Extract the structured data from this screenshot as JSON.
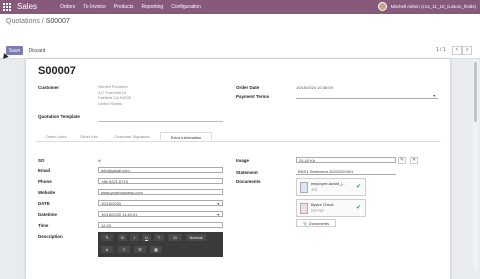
{
  "nav": {
    "app_name": "Sales",
    "menu": [
      "Orders",
      "To Invoice",
      "Products",
      "Reporting",
      "Configuration"
    ],
    "user": "Mitchell Admin (z14_11_10_custom_fields)"
  },
  "breadcrumb": {
    "parent": "Quotations",
    "sep": " / ",
    "current": "S00007"
  },
  "actions": {
    "save": "Save",
    "discard": "Discard"
  },
  "pager": {
    "text": "1 / 1",
    "prev": "<",
    "next": ">"
  },
  "order": {
    "number": "S00007",
    "customer_label": "Customer",
    "customer_lines": [
      "Gemini Furniture",
      "317 Fairchild Dr",
      "Fairfield CA 94535",
      "United States"
    ],
    "quotation_template_label": "Quotation Template",
    "order_date_label": "Order Date",
    "order_date": "10/15/2020 10:38:09",
    "payment_terms_label": "Payment Terms"
  },
  "tabs": [
    "Order Lines",
    "Other Info",
    "Customer Signature",
    "Extra Information"
  ],
  "extra": {
    "so_label": "SO",
    "so_value": "hi",
    "email_label": "Email",
    "email_value": "info@gmail.com",
    "phone_label": "Phone",
    "phone_value": "+86 5221 6715",
    "website_label": "Website",
    "website_value": "www.yourbusiness.com",
    "date_label": "DATE",
    "date_value": "10/15/2020",
    "datetime_label": "Datetime",
    "datetime_value": "10/15/2020 11:40:41",
    "time_label": "Time",
    "time_value": "12.00",
    "description_label": "Description",
    "image_label": "Image",
    "image_value": "25.40 Kb",
    "statement_label": "Statement",
    "statement_value": "BNS1 Statement 20201020001",
    "documents_label": "Documents",
    "doc1_name": "employee-award_j...",
    "doc1_ext": "JPG",
    "doc2_name": "Bystre Check",
    "doc2_ext": "PDF.PDF",
    "documents_button": "Documents"
  },
  "editor": {
    "bold": "B",
    "italic": "I",
    "underline": "U",
    "fontsize": "11",
    "para": "Normal",
    "color": "A",
    "align": "≡",
    "list": "☰",
    "table": "▦"
  }
}
